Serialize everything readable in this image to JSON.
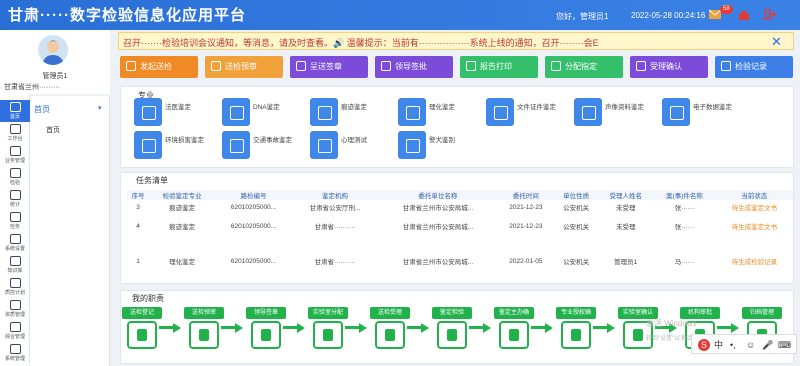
{
  "header": {
    "title": "甘肃·····数字检验信息化应用平台",
    "user_text": "您好，管理员1",
    "datetime": "2022-05-28 00:24:16",
    "badge_count": "58"
  },
  "profile": {
    "name": "管理员1",
    "org": "甘肃省兰州·········"
  },
  "sidebar": {
    "items": [
      {
        "label": "首页",
        "active": true
      },
      {
        "label": "工作台"
      },
      {
        "label": "业务管理"
      },
      {
        "label": "检验"
      },
      {
        "label": "统计"
      },
      {
        "label": "检务"
      },
      {
        "label": "系统设置"
      },
      {
        "label": "知识库"
      },
      {
        "label": "质控计划"
      },
      {
        "label": "资质管理"
      },
      {
        "label": "综合管理"
      },
      {
        "label": "系统管理"
      }
    ]
  },
  "subnav": {
    "head": "首页",
    "child": "首页"
  },
  "notice": {
    "text": "召开·······检验培训会议通知，等消息，请及时查看。🔊 温馨提示：当前有·················系统上线的通知，召开········会E"
  },
  "quick_buttons": [
    {
      "label": "发起送检",
      "color": "#f08a24"
    },
    {
      "label": "送检预审",
      "color": "#f0a13a"
    },
    {
      "label": "呈送签章",
      "color": "#7c4bd9"
    },
    {
      "label": "领导签批",
      "color": "#7c4bd9"
    },
    {
      "label": "报告打印",
      "color": "#34c06a"
    },
    {
      "label": "分配指定",
      "color": "#34c06a"
    },
    {
      "label": "受理确认",
      "color": "#7c4bd9"
    },
    {
      "label": "检验记录",
      "color": "#3d7fe6"
    }
  ],
  "specialties": {
    "title": "专业",
    "items": [
      {
        "label": "法医鉴定"
      },
      {
        "label": "DNA鉴定"
      },
      {
        "label": "痕迹鉴定"
      },
      {
        "label": "理化鉴定"
      },
      {
        "label": "文件证件鉴定"
      },
      {
        "label": "声像资料鉴定"
      },
      {
        "label": "电子数据鉴定"
      },
      {
        "label": "环境损害鉴定"
      },
      {
        "label": "交通事故鉴定"
      },
      {
        "label": "心理测试"
      },
      {
        "label": "警犬鉴别"
      }
    ]
  },
  "tasks": {
    "title": "任务清单",
    "headers": [
      "序号",
      "检验鉴定专业",
      "路检编号",
      "鉴定机构",
      "委托单位名称",
      "委托时间",
      "单位性质",
      "受理人姓名",
      "案(事)件名称",
      "当前状态"
    ],
    "rows": [
      [
        "3",
        "痕迹鉴定",
        "62010205000...",
        "甘肃省公安厅刑...",
        "甘肃省兰州市公安局城...",
        "2021-12-23",
        "公安机关",
        "未受理",
        "张······",
        "待生成鉴定文书"
      ],
      [
        "4",
        "痕迹鉴定",
        "62010205000...",
        "甘肃省··········",
        "甘肃省兰州市公安局城...",
        "2021-12-23",
        "公安机关",
        "未受理",
        "张······",
        "待生成鉴定文书"
      ],
      [
        "1",
        "理化鉴定",
        "62010205000...",
        "甘肃省··········",
        "甘肃省兰州市公安局城...",
        "2022-01-05",
        "公安机关",
        "管理员1",
        "马······",
        "待生成检验记录"
      ]
    ]
  },
  "duties": {
    "title": "我的职责",
    "steps": [
      "送检登记",
      "送检预审",
      "领导签章",
      "实验室分配",
      "送检受理",
      "鉴定检验",
      "鉴定主办确",
      "专业授权确",
      "实验室确认",
      "机构审批",
      "归档管理"
    ]
  },
  "watermark": {
    "line1": "激活 Windows",
    "line2": "转到\"设置\"以激活 Windows。"
  }
}
